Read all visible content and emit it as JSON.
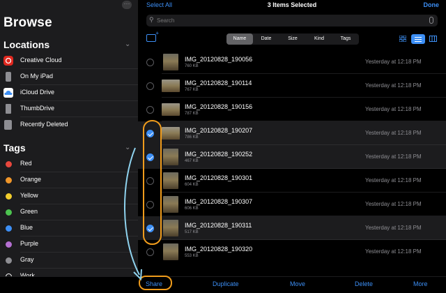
{
  "sidebar": {
    "title": "Browse",
    "more_icon": "ellipsis-icon",
    "locations_label": "Locations",
    "locations": [
      {
        "label": "Creative Cloud",
        "icon": "creative-cloud-icon",
        "color": "#e0281f"
      },
      {
        "label": "On My iPad",
        "icon": "ipad-icon",
        "color": "#8e8e93"
      },
      {
        "label": "iCloud Drive",
        "icon": "icloud-icon",
        "color": "#3d8ff5"
      },
      {
        "label": "ThumbDrive",
        "icon": "usb-drive-icon",
        "color": "#8e8e93"
      },
      {
        "label": "Recently Deleted",
        "icon": "trash-icon",
        "color": "#8e8e93"
      }
    ],
    "tags_label": "Tags",
    "tags": [
      {
        "label": "Red",
        "color": "#e8473d"
      },
      {
        "label": "Orange",
        "color": "#f0962a"
      },
      {
        "label": "Yellow",
        "color": "#f2cd2d"
      },
      {
        "label": "Green",
        "color": "#4cc34f"
      },
      {
        "label": "Blue",
        "color": "#3d8ff5"
      },
      {
        "label": "Purple",
        "color": "#b46fd1"
      },
      {
        "label": "Gray",
        "color": "#8e8e93"
      },
      {
        "label": "Work",
        "color": "#ffffff"
      }
    ]
  },
  "header": {
    "select_all": "Select All",
    "title": "3 Items Selected",
    "done": "Done"
  },
  "search": {
    "placeholder": "Search"
  },
  "sort": {
    "options": [
      "Name",
      "Date",
      "Size",
      "Kind",
      "Tags"
    ],
    "selected": "Name"
  },
  "files": [
    {
      "name": "IMG_20120828_190056",
      "size": "760 KB",
      "date": "Yesterday at 12:18 PM",
      "selected": false,
      "orientation": "portrait"
    },
    {
      "name": "IMG_20120828_190114",
      "size": "767 KB",
      "date": "Yesterday at 12:18 PM",
      "selected": false,
      "orientation": "landscape"
    },
    {
      "name": "IMG_20120828_190156",
      "size": "787 KB",
      "date": "Yesterday at 12:18 PM",
      "selected": false,
      "orientation": "landscape"
    },
    {
      "name": "IMG_20120828_190207",
      "size": "786 KB",
      "date": "Yesterday at 12:18 PM",
      "selected": true,
      "orientation": "landscape"
    },
    {
      "name": "IMG_20120828_190252",
      "size": "467 KB",
      "date": "Yesterday at 12:18 PM",
      "selected": true,
      "orientation": "portrait"
    },
    {
      "name": "IMG_20120828_190301",
      "size": "604 KB",
      "date": "Yesterday at 12:18 PM",
      "selected": false,
      "orientation": "portrait"
    },
    {
      "name": "IMG_20120828_190307",
      "size": "606 KB",
      "date": "Yesterday at 12:18 PM",
      "selected": false,
      "orientation": "portrait"
    },
    {
      "name": "IMG_20120828_190311",
      "size": "517 KB",
      "date": "Yesterday at 12:18 PM",
      "selected": true,
      "orientation": "portrait"
    },
    {
      "name": "IMG_20120828_190320",
      "size": "553 KB",
      "date": "Yesterday at 12:18 PM",
      "selected": false,
      "orientation": "portrait"
    }
  ],
  "toolbar": {
    "share": "Share",
    "duplicate": "Duplicate",
    "move": "Move",
    "delete": "Delete",
    "more": "More"
  },
  "colors": {
    "accent": "#3d8ff5",
    "highlight": "#f09c1c",
    "arrow": "#8fd3ef"
  }
}
